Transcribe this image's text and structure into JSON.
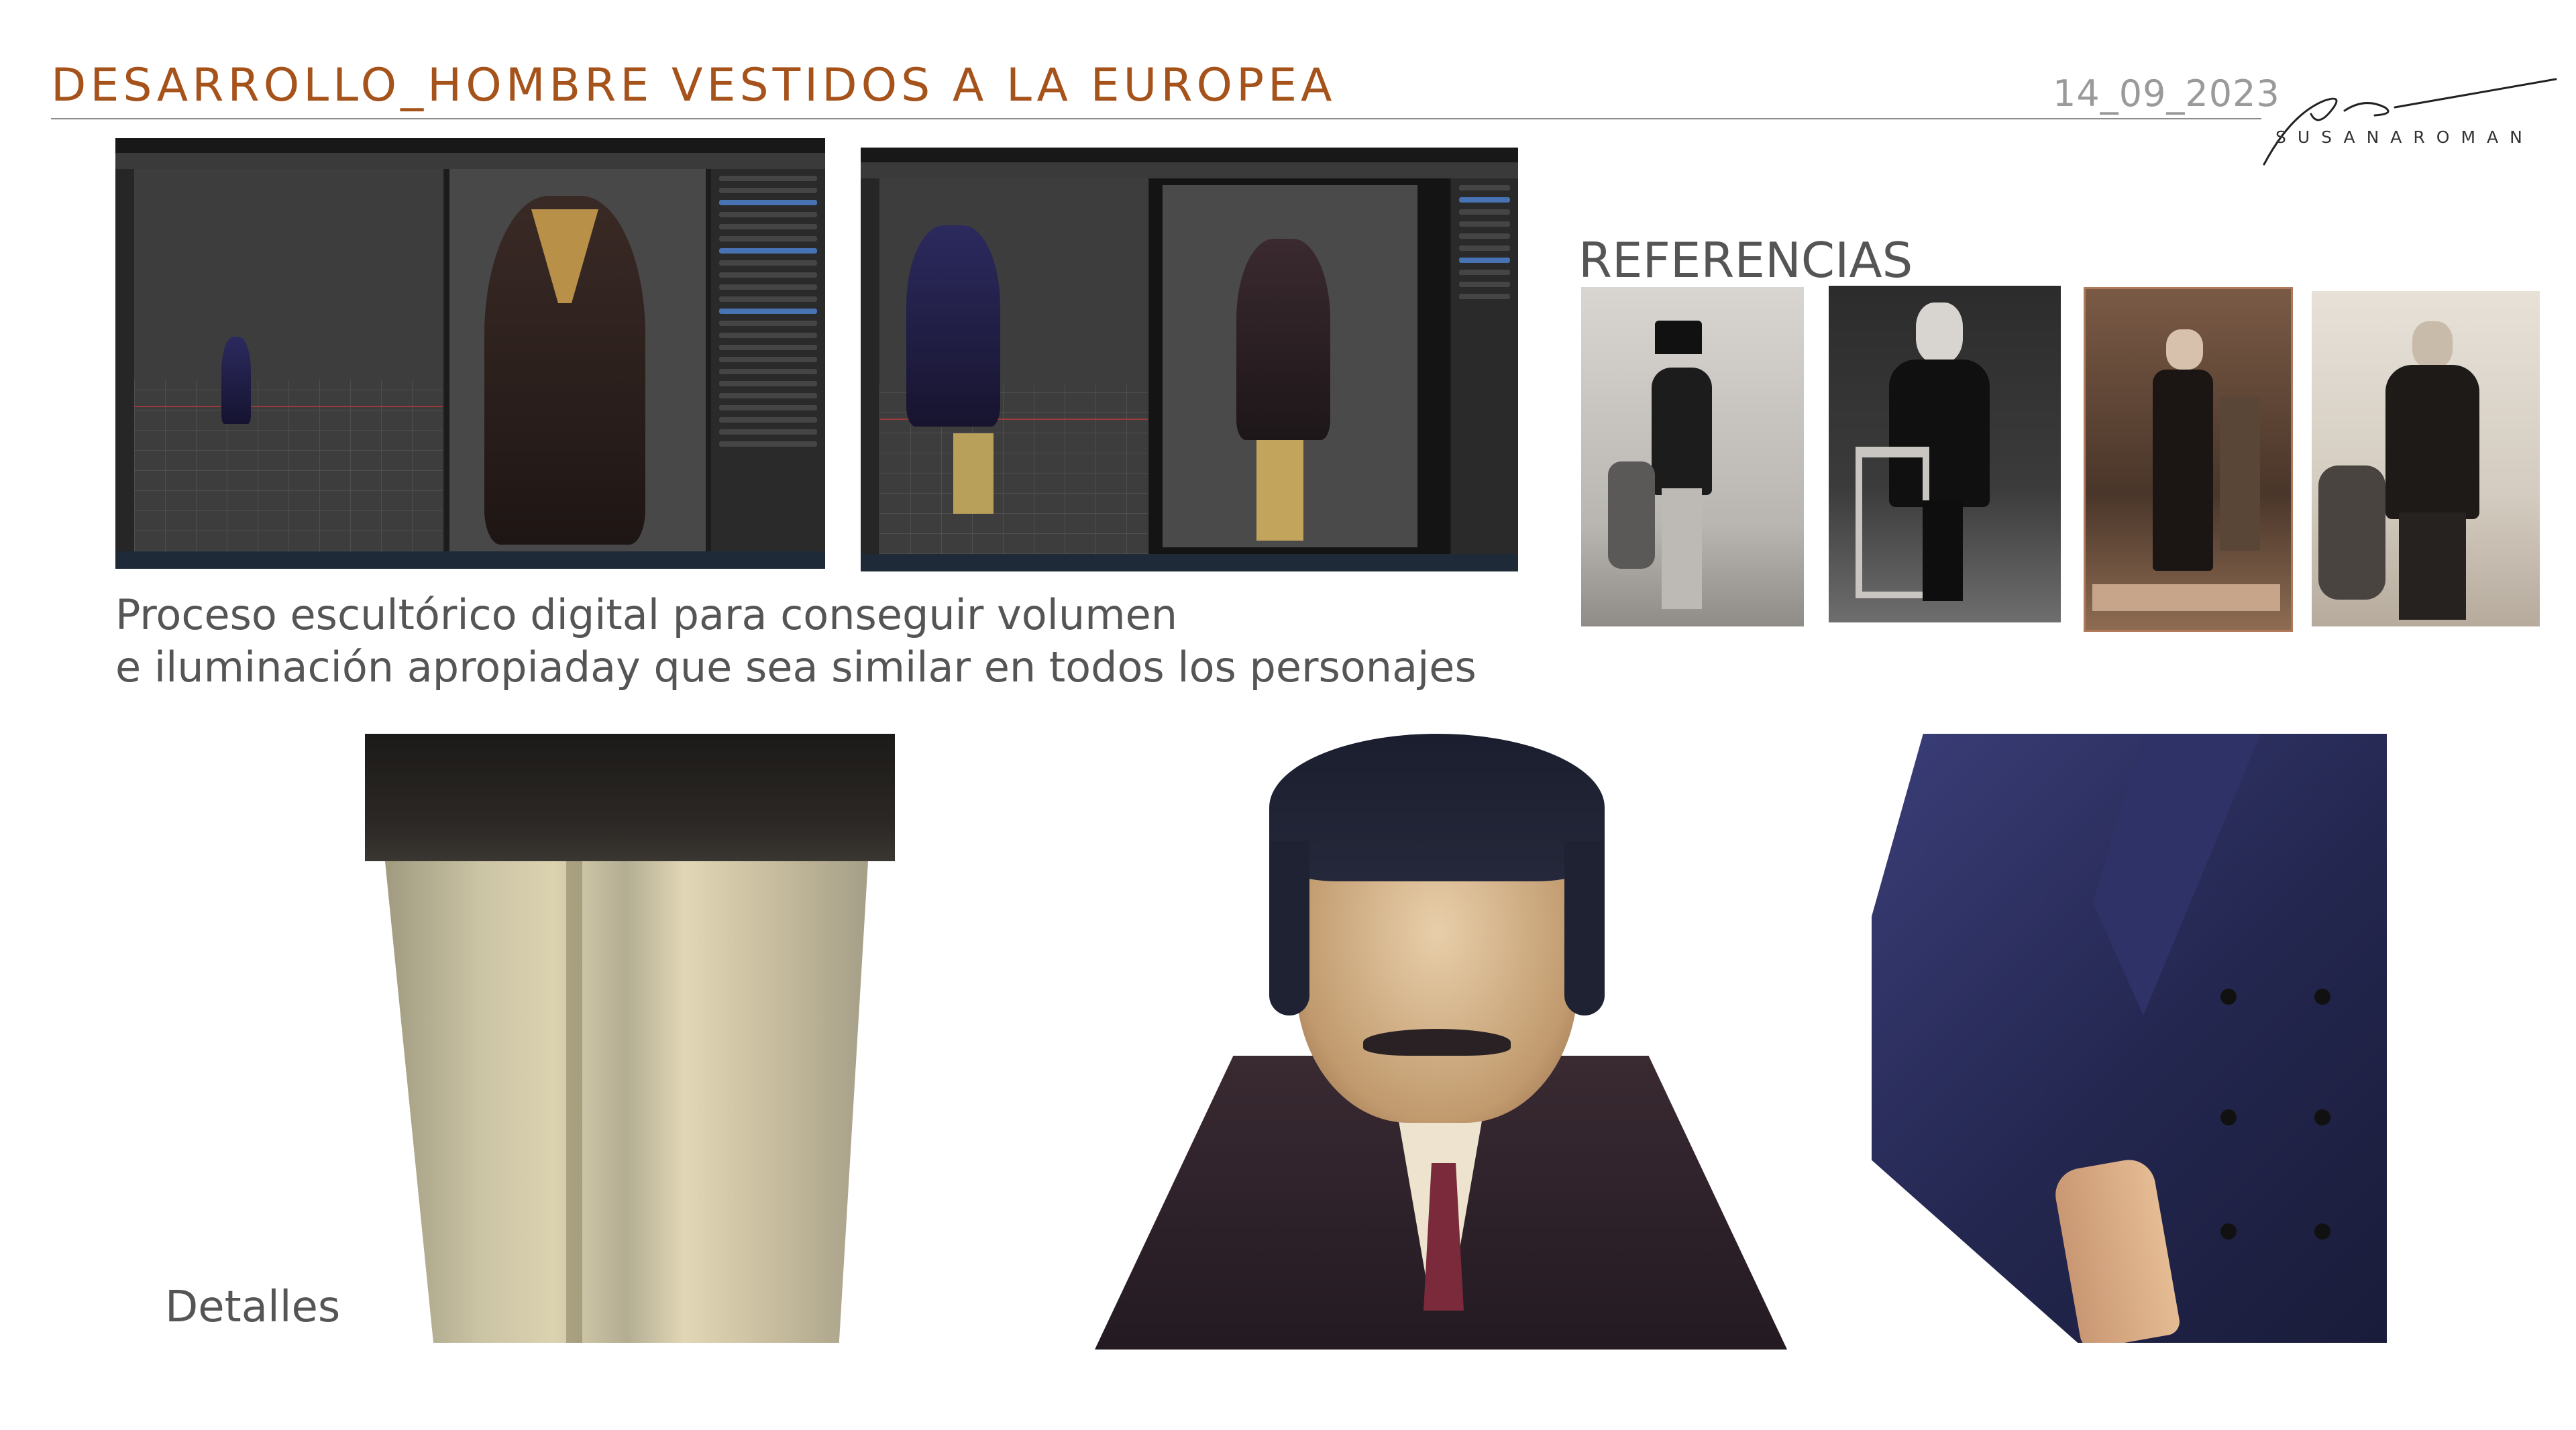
{
  "header": {
    "title": "DESARROLLO_HOMBRE VESTIDOS A LA EUROPEA",
    "date": "14_09_2023",
    "brand": "SUSANAROMAN"
  },
  "screenshots": [
    {
      "name": "Blender sculpting screenshot 1"
    },
    {
      "name": "Blender sculpting screenshot 2"
    }
  ],
  "caption": {
    "line1": "Proceso escultórico digital para conseguir volumen",
    "line2": "e iluminación apropiaday que sea similar en todos los personajes"
  },
  "references": {
    "title": "REFERENCIAS"
  },
  "details": {
    "label": "Detalles"
  },
  "colors": {
    "title": "#a5521b",
    "text": "#555555",
    "date": "#9a9a9a",
    "coat": "#2a2350",
    "trousers": "#d8c89a"
  }
}
